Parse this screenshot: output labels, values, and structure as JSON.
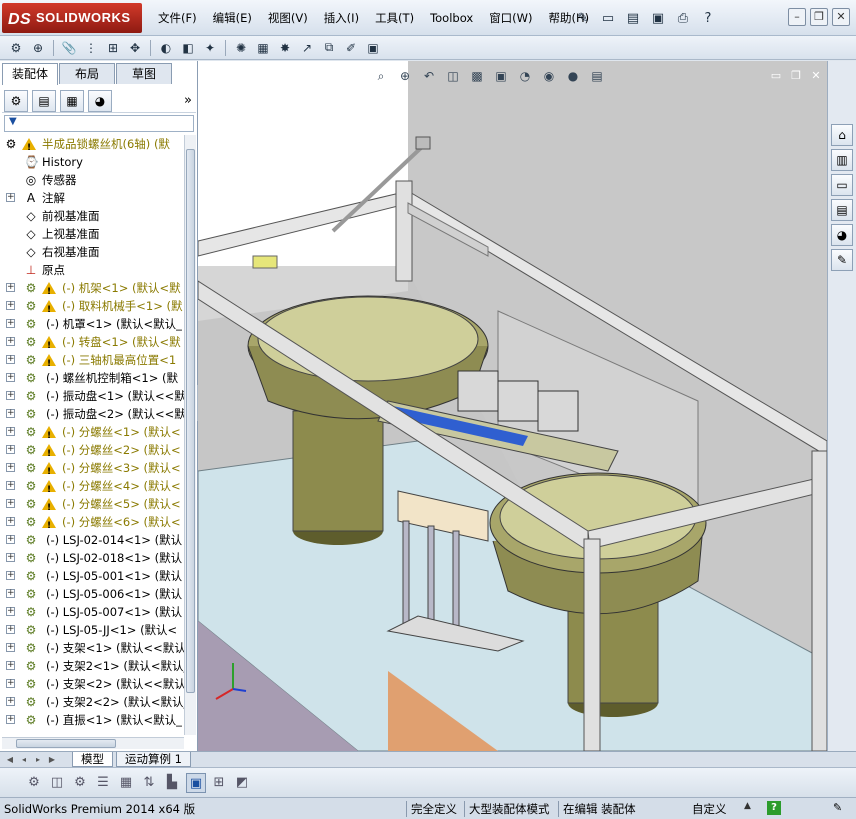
{
  "app": {
    "brand": "SOLIDWORKS",
    "logo_mark": "DS"
  },
  "menu": [
    "文件(F)",
    "编辑(E)",
    "视图(V)",
    "插入(I)",
    "工具(T)",
    "Toolbox",
    "窗口(W)",
    "帮助(H)"
  ],
  "window_controls": {
    "minimize": "–",
    "restore": "❐",
    "close": "✕"
  },
  "panel_tabs": [
    "装配体",
    "布局",
    "草图"
  ],
  "tree": {
    "root": "半成品锁螺丝机(6轴)  (默",
    "items": [
      {
        "icon": "history-icon",
        "text": "History",
        "exp": false
      },
      {
        "icon": "sensor-icon",
        "text": "传感器",
        "exp": false
      },
      {
        "icon": "annotation-icon",
        "text": "注解",
        "exp": true
      },
      {
        "icon": "plane-icon",
        "text": "前视基准面",
        "exp": false
      },
      {
        "icon": "plane-icon",
        "text": "上视基准面",
        "exp": false
      },
      {
        "icon": "plane-icon",
        "text": "右视基准面",
        "exp": false
      },
      {
        "icon": "origin-icon",
        "text": "原点",
        "exp": false
      }
    ],
    "components": [
      {
        "text": "(-) 机架<1> (默认<默",
        "warn": true
      },
      {
        "text": "(-) 取料机械手<1> (默",
        "warn": true
      },
      {
        "text": "(-) 机罩<1> (默认<默认_",
        "warn": false
      },
      {
        "text": "(-) 转盘<1> (默认<默",
        "warn": true
      },
      {
        "text": "(-) 三轴机最高位置<1",
        "warn": true
      },
      {
        "text": "(-) 螺丝机控制箱<1> (默",
        "warn": false
      },
      {
        "text": "(-) 振动盘<1> (默认<<默",
        "warn": false
      },
      {
        "text": "(-) 振动盘<2> (默认<<默",
        "warn": false
      },
      {
        "text": "(-) 分螺丝<1> (默认<",
        "warn": true
      },
      {
        "text": "(-) 分螺丝<2> (默认<",
        "warn": true
      },
      {
        "text": "(-) 分螺丝<3> (默认<",
        "warn": true
      },
      {
        "text": "(-) 分螺丝<4> (默认<",
        "warn": true
      },
      {
        "text": "(-) 分螺丝<5> (默认<",
        "warn": true
      },
      {
        "text": "(-) 分螺丝<6> (默认<",
        "warn": true
      },
      {
        "text": "(-) LSJ-02-014<1> (默认",
        "warn": false
      },
      {
        "text": "(-) LSJ-02-018<1> (默认",
        "warn": false
      },
      {
        "text": "(-) LSJ-05-001<1> (默认",
        "warn": false
      },
      {
        "text": "(-) LSJ-05-006<1> (默认",
        "warn": false
      },
      {
        "text": "(-) LSJ-05-007<1> (默认",
        "warn": false
      },
      {
        "text": "(-) LSJ-05-JJ<1> (默认<",
        "warn": false
      },
      {
        "text": "(-) 支架<1> (默认<<默认_",
        "warn": false
      },
      {
        "text": "(-) 支架2<1> (默认<默认_",
        "warn": false
      },
      {
        "text": "(-) 支架<2> (默认<<默认_",
        "warn": false
      },
      {
        "text": "(-) 支架2<2> (默认<默认_",
        "warn": false
      },
      {
        "text": "(-) 直振<1> (默认<默认_",
        "warn": false
      }
    ]
  },
  "bottom_tabs": [
    "模型",
    "运动算例 1"
  ],
  "status": {
    "version": "SolidWorks Premium 2014 x64 版",
    "fully_defined": "完全定义",
    "large_assembly": "大型装配体模式",
    "editing": "在编辑 装配体",
    "custom": "自定义"
  },
  "colors": {
    "accent": "#1a4fa0",
    "warning": "#e8b000",
    "brand": "#c0281c",
    "viewport_bg": "#c6c6c6"
  }
}
